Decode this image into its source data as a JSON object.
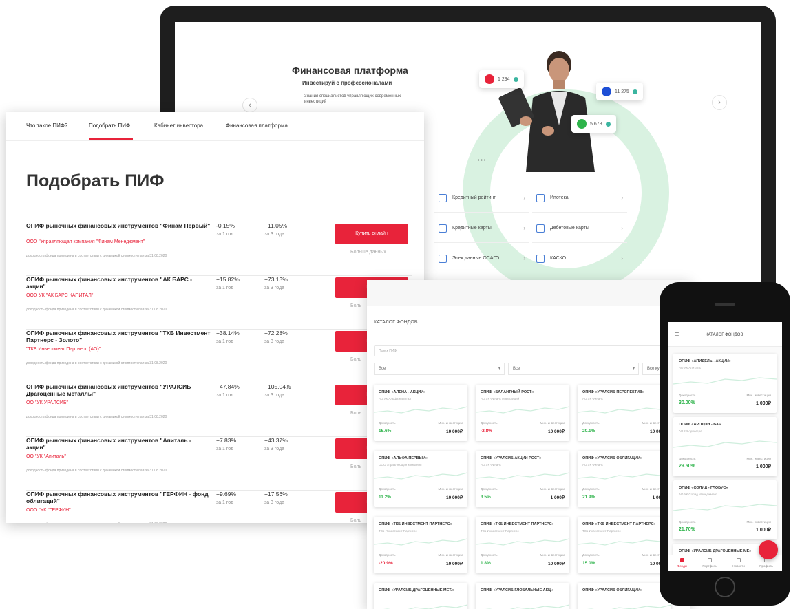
{
  "laptop": {
    "hero_title": "Финансовая платформа",
    "hero_subtitle": "Инвестируй с профессионалами",
    "hero_desc": "Знания специалистов управляющих современных инвестиций",
    "chips": [
      {
        "value": "1 294",
        "color": "#e8233a"
      },
      {
        "value": "11 275",
        "color": "#1d4fd6"
      },
      {
        "value": "5 678",
        "color": "#2db34a"
      }
    ],
    "slide_indicator": "• • •",
    "prev_arrow": "‹",
    "next_arrow": "›",
    "services": [
      {
        "label": "Кредитный рейтинг"
      },
      {
        "label": "Ипотека"
      },
      {
        "label": "Кредитные карты"
      },
      {
        "label": "Дебетовые карты"
      },
      {
        "label": "Элек данные ОСАГО"
      },
      {
        "label": "КАСКО"
      }
    ]
  },
  "pif": {
    "tabs": [
      "Что такое ПИФ?",
      "Подобрать ПИФ",
      "Кабинет инвестора",
      "Финансовая платформа"
    ],
    "title": "Подобрать ПИФ",
    "buy_label": "Купить онлайн",
    "buy_label_short": "Купи",
    "more_label": "Больше данных",
    "more_label_short": "Боль",
    "period_1": "за 1 год",
    "period_3": "за 3 года",
    "note": "доходность фонда приведена в соответствии с динамикой стоимости пая за 31.08.2020",
    "funds": [
      {
        "name": "ОПИФ рыночных финансовых инструментов \"Финам Первый\"",
        "company": "ООО \"Управляющая компания \"Финам Менеджмент\"",
        "y1": "-0.15%",
        "y3": "+11.05%"
      },
      {
        "name": "ОПИФ рыночных финансовых инструментов \"АК БАРС - акции\"",
        "company": "ООО УК \"АК БАРС КАПИТАЛ\"",
        "y1": "+15.82%",
        "y3": "+73.13%"
      },
      {
        "name": "ОПИФ рыночных финансовых инструментов \"ТКБ Инвестмент Партнерс - Золото\"",
        "company": "\"ТКБ Инвестмент Партнерс (АО)\"",
        "y1": "+38.14%",
        "y3": "+72.28%"
      },
      {
        "name": "ОПИФ рыночных финансовых инструментов \"УРАЛСИБ Драгоценные металлы\"",
        "company": "ОО \"УК УРАЛСИБ\"",
        "y1": "+47.84%",
        "y3": "+105.04%"
      },
      {
        "name": "ОПИФ рыночных финансовых инструментов \"Апиталь - акции\"",
        "company": "ОО \"УК \"Апиталь\"",
        "y1": "+7.83%",
        "y3": "+43.37%"
      },
      {
        "name": "ОПИФ рыночных финансовых инструментов \"ГЕРФИН - фонд облигаций\"",
        "company": "ООО \"УК \"ГЕРФИН\"",
        "y1": "+9.69%",
        "y3": "+17.56%"
      }
    ]
  },
  "tablet": {
    "title": "КАТАЛОГ ФОНДОВ",
    "search_placeholder": "Поиск ПИФ",
    "filters": [
      "Все",
      "Все",
      "Все ку"
    ],
    "label_yield": "Доходность",
    "label_min": "Мин. инвестиции",
    "cards": [
      {
        "name": "ОПИФ «АЛЕНА - АКЦИИ»",
        "sub": "АО УК Альфа Капитал",
        "value": "15.6%",
        "color": "green",
        "min": "10 000₽"
      },
      {
        "name": "ОПИФ «БАЛАНТНЫЙ РОСТ»",
        "sub": "АО УК Финанс Инвестиций",
        "value": "-2.8%",
        "color": "red",
        "min": "10 000₽"
      },
      {
        "name": "ОПИФ «УРАЛСИБ ПЕРСПЕКТИВ»",
        "sub": "АО УК Финанс",
        "value": "20.1%",
        "color": "green",
        "min": "10 000₽"
      },
      {
        "name": "ОПИФ «АЛЬФА ПЕРВЫЙ»",
        "sub": "ООО Управляющая компания",
        "value": "11.2%",
        "color": "green",
        "min": "10 000₽"
      },
      {
        "name": "ОПИФ «УРАЛСИБ АКЦИИ РОСТ»",
        "sub": "АО УК Финанс",
        "value": "3.5%",
        "color": "green",
        "min": "1 000₽"
      },
      {
        "name": "ОПИФ «УРАЛСИБ ОБЛИГАЦИИ»",
        "sub": "АО УК Финанс",
        "value": "21.9%",
        "color": "green",
        "min": "1 000₽"
      },
      {
        "name": "ОПИФ «ТКБ ИНВЕСТМЕНТ ПАРТНЕРС»",
        "sub": "ТКБ Инвестмент Партнерс",
        "value": "-20.9%",
        "color": "red",
        "min": "10 000₽"
      },
      {
        "name": "ОПИФ «ТКБ ИНВЕСТМЕНТ ПАРТНЕРС»",
        "sub": "ТКБ Инвестмент Партнерс",
        "value": "1.8%",
        "color": "green",
        "min": "10 000₽"
      },
      {
        "name": "ОПИФ «ТКБ ИНВЕСТМЕНТ ПАРТНЕРС»",
        "sub": "ТКБ Инвестмент Партнерс",
        "value": "15.0%",
        "color": "green",
        "min": "10 000₽"
      },
      {
        "name": "ОПИФ «УРАЛСИБ ДРАГОЦЕННЫЕ МЕТ.»",
        "sub": "",
        "value": "",
        "color": "green",
        "min": ""
      },
      {
        "name": "ОПИФ «УРАЛСИБ ГЛОБАЛЬНЫЕ АКЦ.»",
        "sub": "",
        "value": "",
        "color": "green",
        "min": ""
      },
      {
        "name": "ОПИФ «УРАЛСИБ ОБЛИГАЦИИ»",
        "sub": "",
        "value": "",
        "color": "green",
        "min": ""
      }
    ]
  },
  "phone": {
    "title": "КАТАЛОГ ФОНДОВ",
    "menu_icon": "≡",
    "label_yield": "Доходность",
    "label_min": "Мин. инвестиции",
    "cards": [
      {
        "name": "ОПИФ «АПИДЕЛЬ - АКЦИИ»",
        "sub": "АО УК Апиталь",
        "value": "30.00%",
        "min": "1 000₽"
      },
      {
        "name": "ОПИФ «АРОДОН - БА»",
        "sub": "АО УК Арсагера",
        "value": "29.50%",
        "min": "1 000₽"
      },
      {
        "name": "ОПИФ «СОЛИД - ГЛОБУС»",
        "sub": "АО УК Солид Менеджмент",
        "value": "21.70%",
        "min": "1 000₽"
      },
      {
        "name": "ОПИФ «УРАЛСИБ ДРАГОЦЕННЫЕ МЕ»",
        "sub": "",
        "value": "",
        "min": ""
      }
    ],
    "nav": [
      "Фонды",
      "Портфель",
      "Новости",
      "Профиль"
    ]
  },
  "colors": {
    "accent": "#e8233a",
    "green": "#2db34a",
    "hero_arc": "#d9f2e1"
  }
}
